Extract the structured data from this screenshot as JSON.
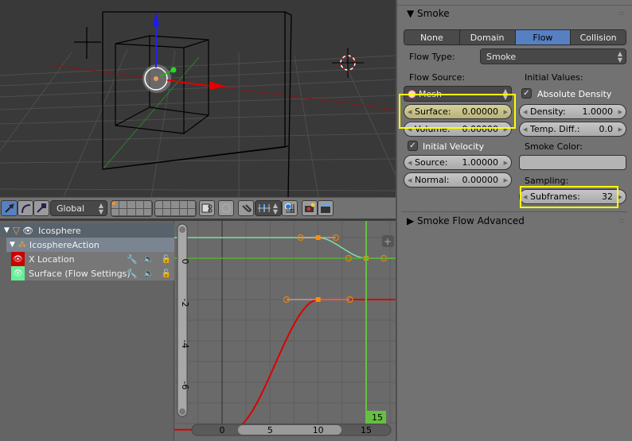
{
  "viewport": {
    "toolbar": {
      "manipulator_modes": [
        "translate",
        "rotate",
        "scale"
      ],
      "orientation": "Global"
    }
  },
  "dopesheet": {
    "channels": [
      {
        "label": "Icosphere",
        "type": "object"
      },
      {
        "label": "IcosphereAction",
        "type": "action"
      },
      {
        "label": "X Location",
        "type": "fcurve",
        "color": "#cc0000"
      },
      {
        "label": "Surface (Flow Settings)",
        "type": "fcurve",
        "color": "#66ee99"
      }
    ]
  },
  "graph_editor": {
    "y_ticks": [
      "0",
      "-2",
      "-4",
      "-6"
    ],
    "x_ticks": [
      "0",
      "5",
      "10",
      "15"
    ],
    "current_frame": "15",
    "curves": [
      {
        "name": "Surface (Flow Settings)",
        "color": "#7de0a6",
        "keyframes": [
          [
            10,
            1.0
          ],
          [
            15,
            0.0
          ]
        ]
      },
      {
        "name": "X Location",
        "color": "#dd0000",
        "keyframes": [
          [
            1,
            -8.3
          ],
          [
            10,
            -2.0
          ]
        ]
      }
    ]
  },
  "props": {
    "panel_title": "Smoke",
    "tabs": [
      "None",
      "Domain",
      "Flow",
      "Collision"
    ],
    "active_tab": "Flow",
    "flow_type_label": "Flow Type:",
    "flow_type_value": "Smoke",
    "flow_source_label": "Flow Source:",
    "flow_source_value": "Mesh",
    "surface_label": "Surface:",
    "surface_value": "0.00000",
    "volume_label": "Volume:",
    "volume_value": "0.00000",
    "initial_velocity_label": "Initial Velocity",
    "initial_velocity_checked": true,
    "source_label": "Source:",
    "source_value": "1.00000",
    "normal_label": "Normal:",
    "normal_value": "0.00000",
    "initial_values_label": "Initial Values:",
    "absolute_density_label": "Absolute Density",
    "absolute_density_checked": true,
    "density_label": "Density:",
    "density_value": "1.0000",
    "temp_diff_label": "Temp. Diff.:",
    "temp_diff_value": "0.0",
    "smoke_color_label": "Smoke Color:",
    "smoke_color": "#b4b4b4",
    "sampling_label": "Sampling:",
    "subframes_label": "Subframes:",
    "subframes_value": "32",
    "advanced_panel_title": "Smoke Flow Advanced"
  }
}
